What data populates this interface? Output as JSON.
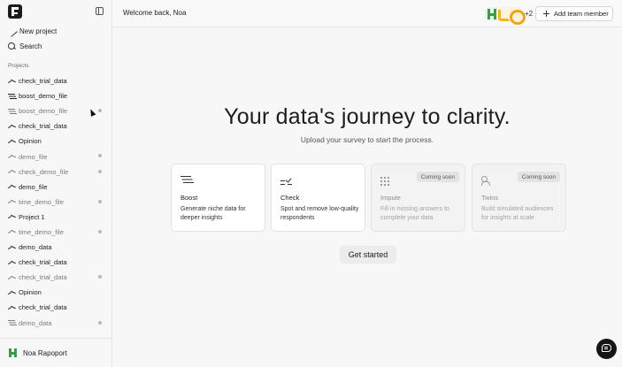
{
  "sidebar": {
    "new_project": "New project",
    "search": "Search",
    "projects_label": "Projects",
    "projects": [
      {
        "label": "check_trial_data",
        "icon": "trend-icon",
        "dim": false,
        "dot": false
      },
      {
        "label": "boost_demo_file",
        "icon": "lines-icon",
        "dim": false,
        "dot": false
      },
      {
        "label": "boost_demo_file",
        "icon": "lines-icon",
        "dim": true,
        "dot": true
      },
      {
        "label": "check_trial_data",
        "icon": "trend-icon",
        "dim": false,
        "dot": false
      },
      {
        "label": "Opinion",
        "icon": "trend-icon",
        "dim": false,
        "dot": false
      },
      {
        "label": "demo_file",
        "icon": "trend-icon",
        "dim": true,
        "dot": true
      },
      {
        "label": "check_demo_file",
        "icon": "trend-icon",
        "dim": true,
        "dot": true
      },
      {
        "label": "demo_file",
        "icon": "trend-icon",
        "dim": false,
        "dot": false
      },
      {
        "label": "time_demo_file",
        "icon": "trend-icon",
        "dim": true,
        "dot": true
      },
      {
        "label": "Project 1",
        "icon": "trend-icon",
        "dim": false,
        "dot": false
      },
      {
        "label": "time_demo_file",
        "icon": "trend-icon",
        "dim": true,
        "dot": true
      },
      {
        "label": "demo_data",
        "icon": "trend-icon",
        "dim": false,
        "dot": false
      },
      {
        "label": "check_trial_data",
        "icon": "trend-icon",
        "dim": false,
        "dot": false
      },
      {
        "label": "check_trial_data",
        "icon": "trend-icon",
        "dim": true,
        "dot": true
      },
      {
        "label": "Opinion",
        "icon": "trend-icon",
        "dim": false,
        "dot": false
      },
      {
        "label": "check_trial_data",
        "icon": "trend-icon",
        "dim": false,
        "dot": false
      },
      {
        "label": "demo_data",
        "icon": "lines-icon",
        "dim": true,
        "dot": true
      }
    ],
    "user_name": "Noa Rapoport"
  },
  "header": {
    "welcome": "Welcome back, Noa",
    "more_members": "+2",
    "add_member": "Add team member"
  },
  "main": {
    "title": "Your data's journey to clarity.",
    "subtitle": "Upload your survey to start the process.",
    "cards": [
      {
        "title": "Boost",
        "desc": "Generate niche data for deeper insights",
        "icon": "filter-icon",
        "disabled": false,
        "badge": ""
      },
      {
        "title": "Check",
        "desc": "Spot and remove low-quality respondents",
        "icon": "check-icon",
        "disabled": false,
        "badge": ""
      },
      {
        "title": "Impute",
        "desc": "Fill in missing answers to complete your data",
        "icon": "grid-icon",
        "disabled": true,
        "badge": "Coming soon"
      },
      {
        "title": "Twins",
        "desc": "Build simulated audiences for insights at scale",
        "icon": "people-icon",
        "disabled": true,
        "badge": "Coming soon"
      }
    ],
    "get_started": "Get started"
  }
}
